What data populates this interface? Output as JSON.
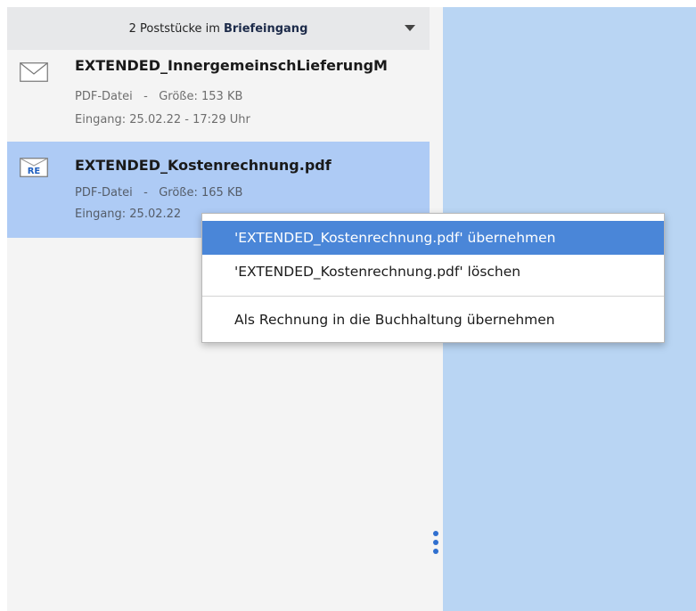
{
  "inbox": {
    "count_text": "2 Poststücke im",
    "folder": "Briefeingang",
    "items": [
      {
        "title": "EXTENDED_InnergemeinschLieferungM",
        "type": "PDF-Datei",
        "separator": "-",
        "size": "Größe: 153 KB",
        "received": "Eingang: 25.02.22 - 17:29 Uhr",
        "icon": "envelope-icon"
      },
      {
        "title": "EXTENDED_Kostenrechnung.pdf",
        "type": "PDF-Datei",
        "separator": "-",
        "size": "Größe: 165 KB",
        "received": "Eingang: 25.02.22",
        "icon": "invoice-envelope-icon",
        "icon_text": "RE"
      }
    ]
  },
  "context_menu": {
    "items": [
      {
        "label": "'EXTENDED_Kostenrechnung.pdf' übernehmen"
      },
      {
        "label": "'EXTENDED_Kostenrechnung.pdf' löschen"
      },
      {
        "label": "Als Rechnung in die Buchhaltung übernehmen"
      }
    ]
  },
  "colors": {
    "selected_item": "#aecbf5",
    "menu_highlight": "#4a86d8",
    "right_panel": "#b9d5f3",
    "accent": "#2f6fcf"
  }
}
